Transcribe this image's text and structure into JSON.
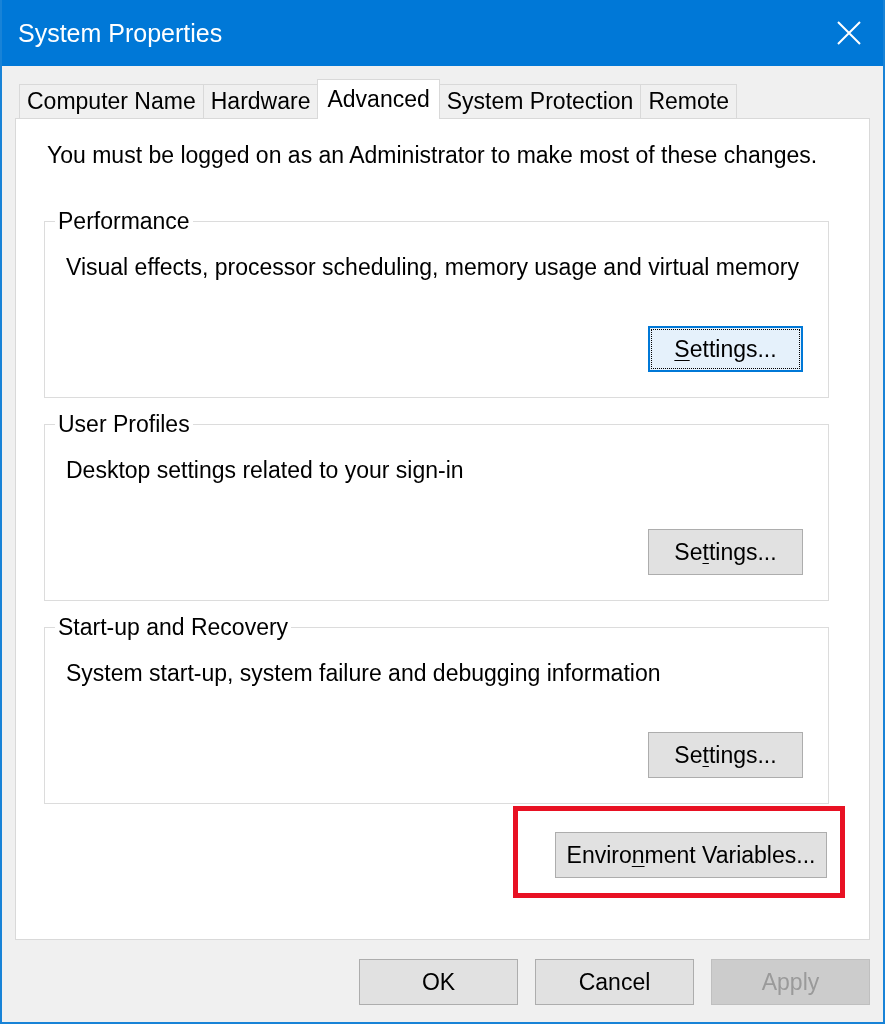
{
  "window": {
    "title": "System Properties"
  },
  "tabs": [
    {
      "label": "Computer Name",
      "selected": false
    },
    {
      "label": "Hardware",
      "selected": false
    },
    {
      "label": "Advanced",
      "selected": true
    },
    {
      "label": "System Protection",
      "selected": false
    },
    {
      "label": "Remote",
      "selected": false
    }
  ],
  "notice": "You must be logged on as an Administrator to make most of these changes.",
  "groups": [
    {
      "title": "Performance",
      "description": "Visual effects, processor scheduling, memory usage and virtual memory",
      "button": {
        "access_key": "S",
        "label_end": "ettings...",
        "focused": true
      }
    },
    {
      "title": "User Profiles",
      "description": "Desktop settings related to your sign-in",
      "button": {
        "label_start": "Se",
        "access_key": "t",
        "label_end": "tings...",
        "focused": false
      }
    },
    {
      "title": "Start-up and Recovery",
      "description": "System start-up, system failure and debugging information",
      "button": {
        "label_start": "Se",
        "access_key": "t",
        "label_end": "tings...",
        "focused": false
      }
    }
  ],
  "environment_button": {
    "label_start": "Enviro",
    "access_key": "n",
    "label_end": "ment Variables...",
    "highlighted": true
  },
  "dialog_buttons": [
    {
      "label": "OK",
      "disabled": false
    },
    {
      "label": "Cancel",
      "disabled": false
    },
    {
      "label": "Apply",
      "disabled": true
    }
  ]
}
